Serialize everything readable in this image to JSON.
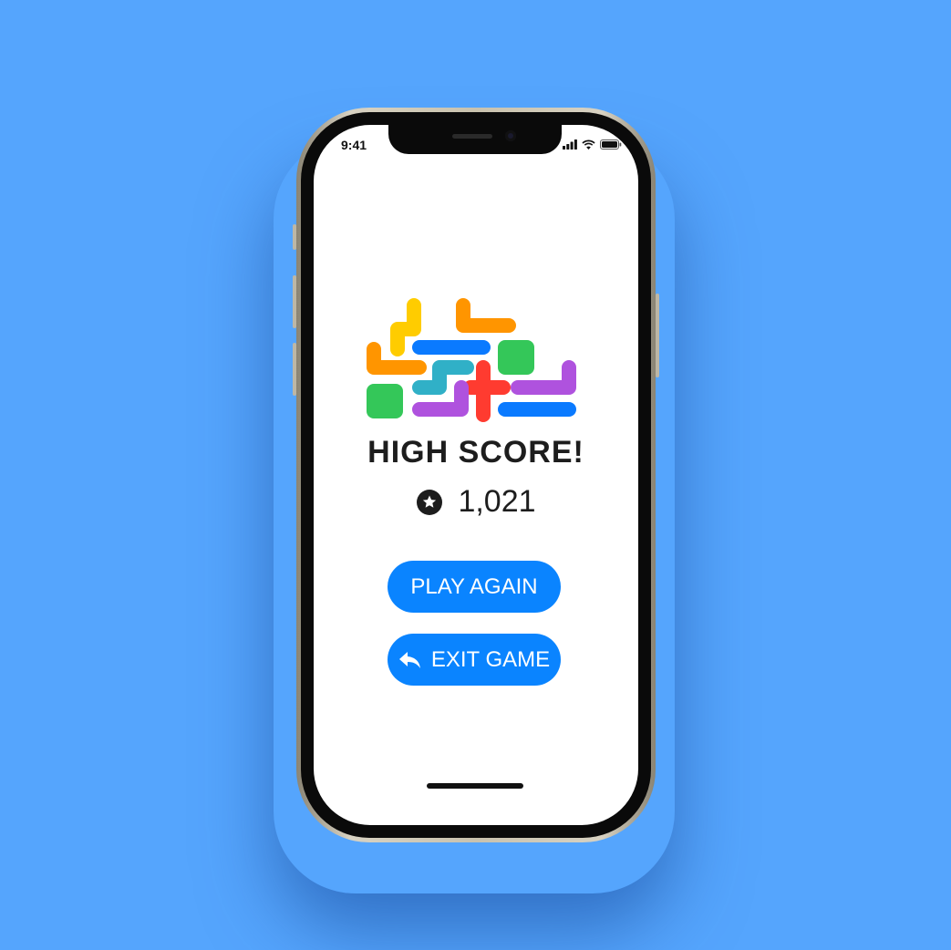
{
  "status_bar": {
    "time": "9:41",
    "icons": [
      "cellular-signal-icon",
      "wifi-icon",
      "battery-icon"
    ]
  },
  "logo": {
    "icon": "colorful-blocks-logo",
    "colors": [
      "#ffcc00",
      "#ff9500",
      "#0a7aff",
      "#34c759",
      "#30b0c7",
      "#ff3b30",
      "#af52de"
    ]
  },
  "title": "HIGH SCORE!",
  "score": {
    "icon": "star-circle-icon",
    "value": "1,021"
  },
  "buttons": {
    "play_again": "PLAY AGAIN",
    "exit_game": "EXIT GAME",
    "exit_icon": "reply-arrow-icon"
  },
  "colors": {
    "background": "#55a5fd",
    "accent": "#0a84ff"
  }
}
